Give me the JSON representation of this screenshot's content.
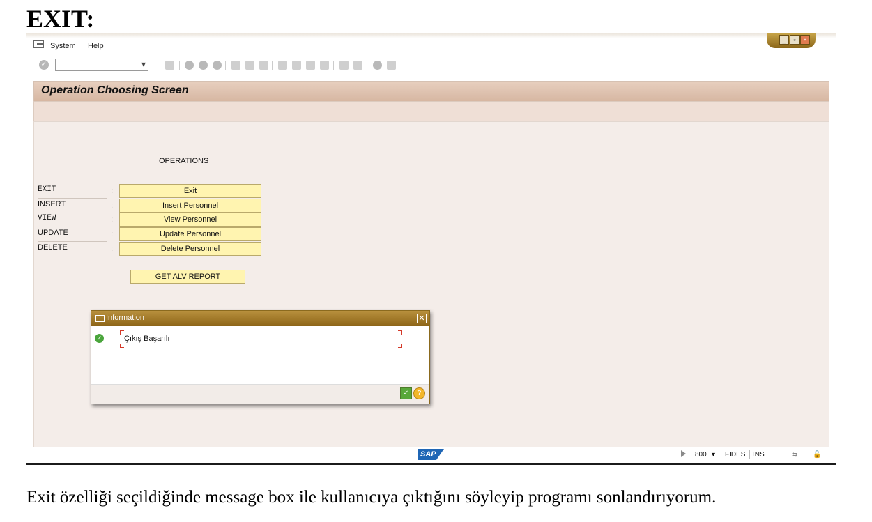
{
  "doc": {
    "heading": "EXIT:",
    "caption": "Exit özelliği seçildiğinde message box ile kullanıcıya çıktığını söyleyip programı sonlandırıyorum."
  },
  "menu": {
    "system": "System",
    "help": "Help"
  },
  "screen": {
    "title": "Operation Choosing Screen"
  },
  "operations": {
    "title": "OPERATIONS",
    "rows": [
      {
        "label": "EXIT",
        "colon": ":",
        "button": "Exit"
      },
      {
        "label": "INSERT",
        "colon": ":",
        "button": "Insert Personnel"
      },
      {
        "label": "VIEW",
        "colon": ":",
        "button": "View Personnel"
      },
      {
        "label": "UPDATE",
        "colon": ":",
        "button": "Update Personnel"
      },
      {
        "label": "DELETE",
        "colon": ":",
        "button": "Delete Personnel"
      }
    ],
    "alv_button": "GET ALV REPORT"
  },
  "dialog": {
    "title": "Information",
    "message": "Çıkış Başarılı",
    "close": "✕"
  },
  "status": {
    "client": "800",
    "system": "FIDES",
    "mode": "INS",
    "logo": "SAP"
  },
  "colors": {
    "button_bg": "#fff4b0",
    "dialog_header": "#8d6518",
    "title_bar": "#d7b7a2"
  }
}
